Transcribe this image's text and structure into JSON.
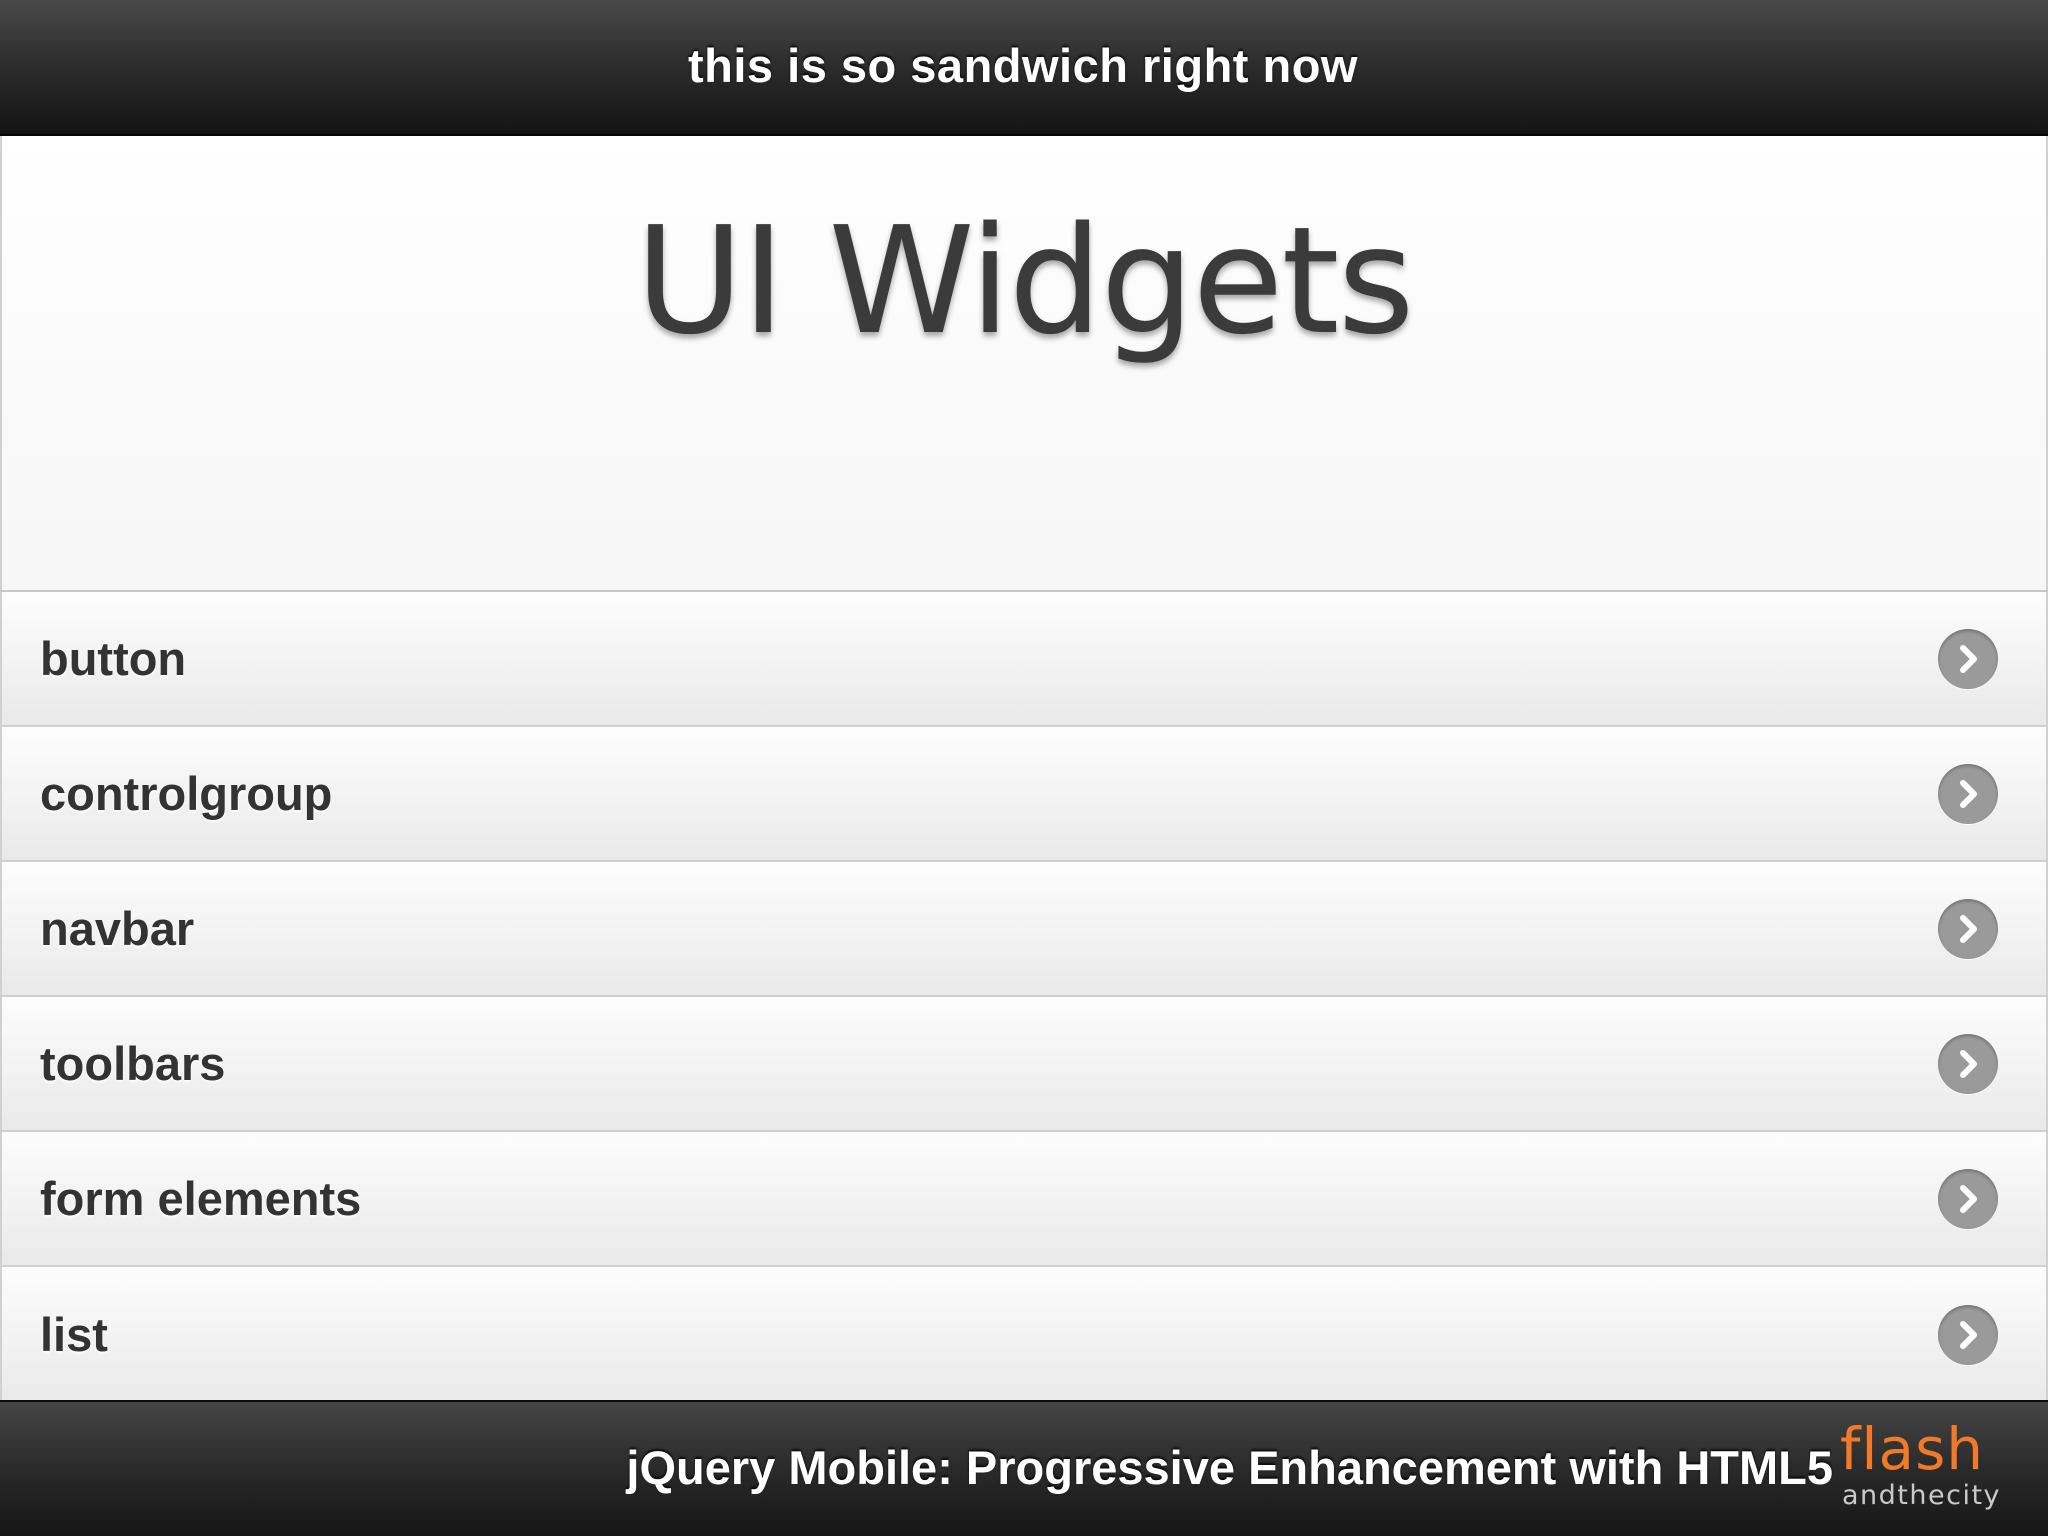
{
  "header": {
    "title": "this is so sandwich right now"
  },
  "content": {
    "heading": "UI Widgets"
  },
  "list": {
    "items": [
      {
        "label": "button",
        "icon": "chevron-right-icon"
      },
      {
        "label": "controlgroup",
        "icon": "chevron-right-icon"
      },
      {
        "label": "navbar",
        "icon": "chevron-right-icon"
      },
      {
        "label": "toolbars",
        "icon": "chevron-right-icon"
      },
      {
        "label": "form elements",
        "icon": "chevron-right-icon"
      },
      {
        "label": "list",
        "icon": "chevron-right-icon"
      }
    ]
  },
  "footer": {
    "title": "jQuery Mobile: Progressive Enhancement with HTML5",
    "logo_main": "flash",
    "logo_sub": "andthecity"
  },
  "colors": {
    "header_bg": "#2e2e2e",
    "footer_bg": "#2a2a2a",
    "list_text": "#333333",
    "arrow_bg": "#9a9a9a",
    "logo_accent": "#f07a2a",
    "logo_sub": "#c9c9c9"
  }
}
